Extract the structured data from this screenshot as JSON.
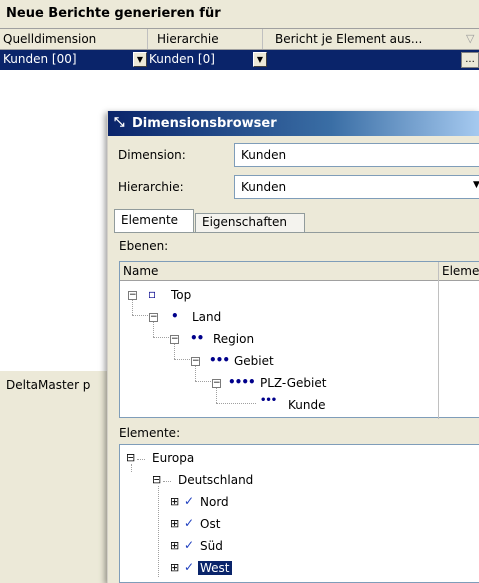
{
  "background": {
    "title": "Neue Berichte generieren für",
    "columns": [
      "Quelldimension",
      "Hierarchie",
      "Bericht je Element aus..."
    ],
    "row": {
      "quelldimension": "Kunden [00]",
      "hierarchie": "Kunden [0]",
      "ellipsis": "..."
    },
    "deltamaster_label": "DeltaMaster p"
  },
  "dialog": {
    "title": "Dimensionsbrowser",
    "dimension_label": "Dimension:",
    "dimension_value": "Kunden",
    "hierarchy_label": "Hierarchie:",
    "hierarchy_value": "Kunden",
    "tabs": [
      "Elemente",
      "Eigenschaften"
    ],
    "levels_label": "Ebenen:",
    "levels_columns": [
      "Name",
      "Eleme"
    ],
    "levels": [
      "Top",
      "Land",
      "Region",
      "Gebiet",
      "PLZ-Gebiet",
      "Kunde"
    ],
    "elements_label": "Elemente:",
    "elements": [
      "Europa",
      "Deutschland",
      "Nord",
      "Ost",
      "Süd",
      "West"
    ]
  },
  "colors": {
    "selection": "#0a246a",
    "title_bar": "#0a246a",
    "check": "#1f3fbf"
  }
}
